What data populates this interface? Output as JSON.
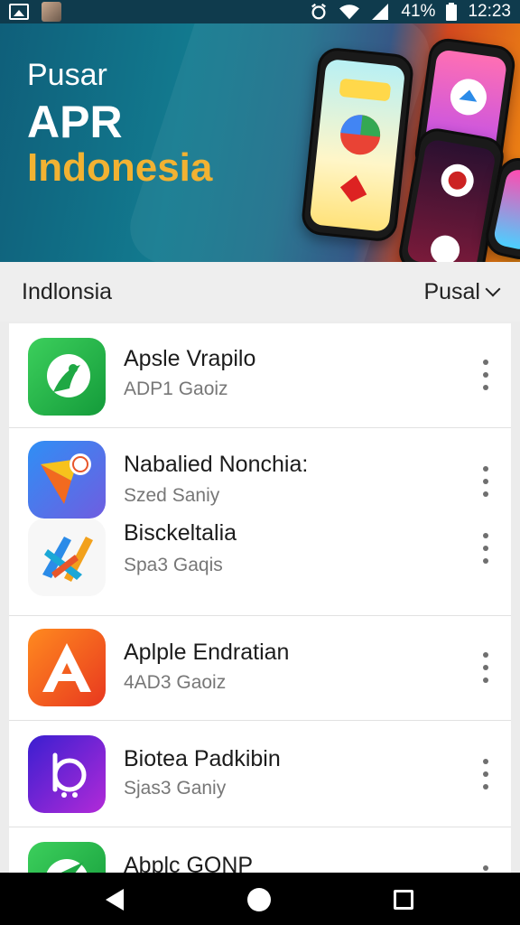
{
  "status_bar": {
    "battery": "41%",
    "time": "12:23"
  },
  "banner": {
    "line1": "Pusar",
    "line2": "APR",
    "line3": "Indonesia"
  },
  "section": {
    "title": "Indlonsia",
    "filter_label": "Pusal"
  },
  "apps": [
    {
      "name": "Apsle Vrapilo",
      "sub": "ADP1 Gaoiz"
    },
    {
      "name": "Nabalied Nonchia:",
      "sub": "Szed Saniy"
    },
    {
      "name": "Bisckeltalia",
      "sub": "Spa3 Gaqis"
    },
    {
      "name": "Aplple Endratian",
      "sub": "4AD3 Gaoiz"
    },
    {
      "name": "Biotea Padkibin",
      "sub": "Sjas3 Ganiy"
    },
    {
      "name": "Abplc GONP",
      "sub": ""
    }
  ],
  "colors": {
    "accent_yellow": "#f2b232",
    "green": "#2bb24c",
    "orange": "#f25a1f",
    "purple": "#6a2bd6"
  }
}
